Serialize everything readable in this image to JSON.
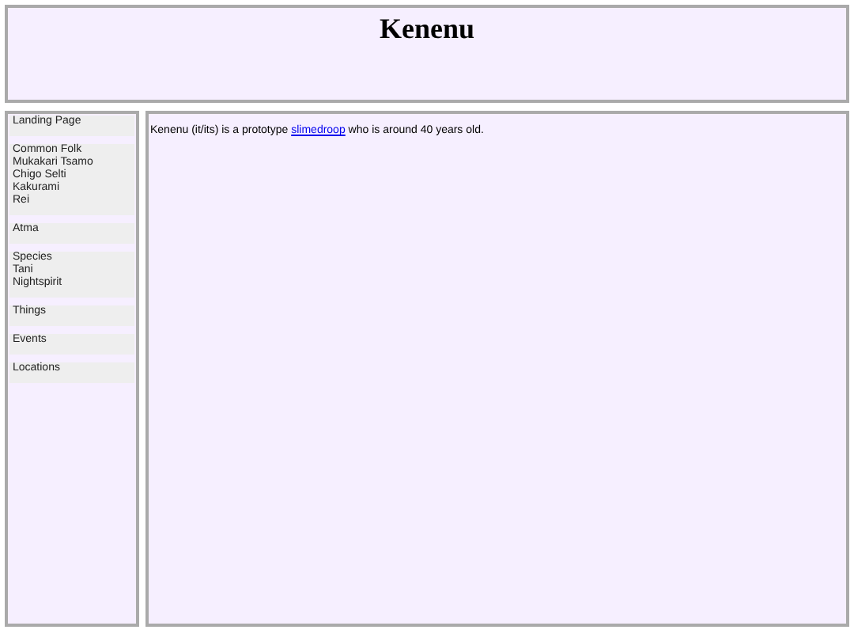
{
  "title": "Kenenu",
  "sidebar": {
    "groups": [
      {
        "items": [
          "Landing Page"
        ]
      },
      {
        "items": [
          "Common Folk",
          "Mukakari Tsamo",
          "Chigo Selti",
          "Kakurami",
          "Rei"
        ]
      },
      {
        "items": [
          "Atma"
        ]
      },
      {
        "items": [
          "Species",
          "Tani",
          "Nightspirit"
        ]
      },
      {
        "items": [
          "Things"
        ]
      },
      {
        "items": [
          "Events"
        ]
      },
      {
        "items": [
          "Locations"
        ]
      }
    ]
  },
  "content": {
    "paragraph": {
      "before": "Kenenu (it/its) is a prototype ",
      "link": "slimedroop",
      "after": " who is around 40 years old."
    }
  }
}
